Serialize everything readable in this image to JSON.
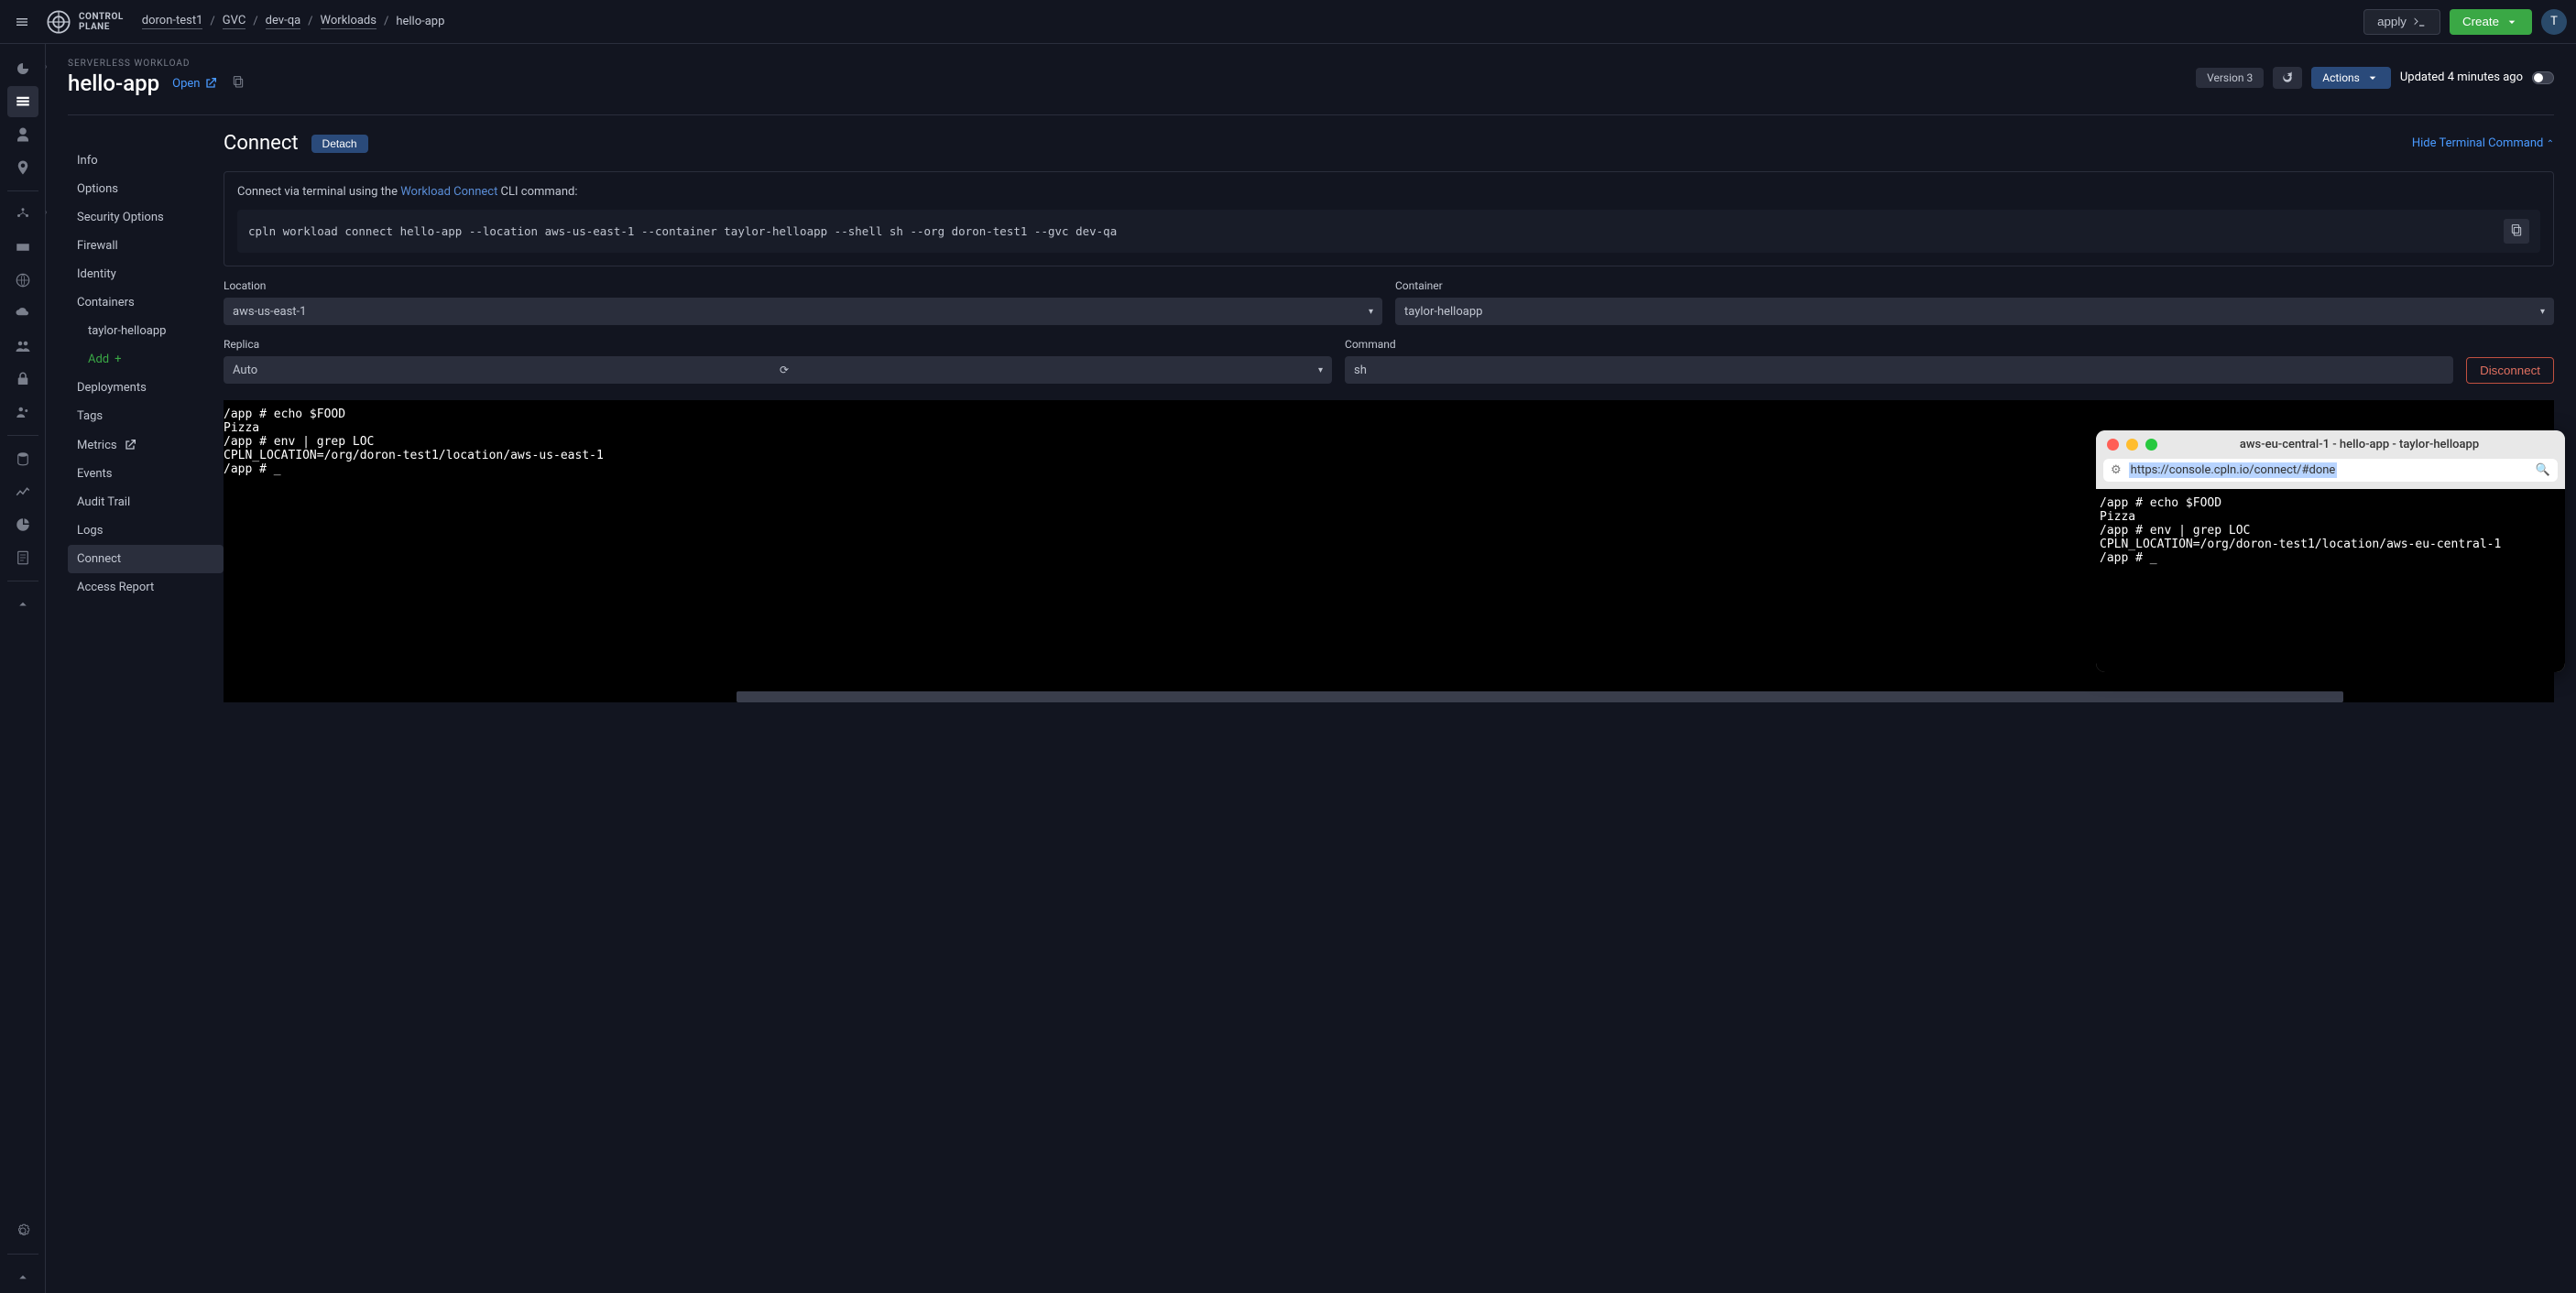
{
  "top": {
    "logo_line1": "CONTROL",
    "logo_line2": "PLANE",
    "breadcrumbs": [
      "doron-test1",
      "GVC",
      "dev-qa",
      "Workloads",
      "hello-app"
    ],
    "apply": "apply",
    "create": "Create",
    "avatar_letter": "T"
  },
  "header": {
    "subtitle": "SERVERLESS WORKLOAD",
    "title": "hello-app",
    "open": "Open",
    "version": "Version 3",
    "actions": "Actions",
    "updated": "Updated 4 minutes ago"
  },
  "sidenav": {
    "items": [
      "Info",
      "Options",
      "Security Options",
      "Firewall",
      "Identity",
      "Containers"
    ],
    "container_child": "taylor-helloapp",
    "add": "Add",
    "items2": [
      "Deployments",
      "Tags",
      "Metrics",
      "Events",
      "Audit Trail",
      "Logs",
      "Connect",
      "Access Report"
    ],
    "active": "Connect"
  },
  "connect": {
    "title": "Connect",
    "detach": "Detach",
    "hide": "Hide Terminal Command",
    "instr_pre": "Connect via terminal using the ",
    "instr_link": "Workload Connect",
    "instr_post": " CLI command:",
    "cmd": "cpln workload connect hello-app --location aws-us-east-1 --container taylor-helloapp --shell sh --org doron-test1 --gvc dev-qa",
    "fields": {
      "location_label": "Location",
      "location_value": "aws-us-east-1",
      "container_label": "Container",
      "container_value": "taylor-helloapp",
      "replica_label": "Replica",
      "replica_value": "Auto",
      "command_label": "Command",
      "command_value": "sh"
    },
    "disconnect": "Disconnect"
  },
  "terminal": "/app # echo $FOOD\nPizza\n/app # env | grep LOC\nCPLN_LOCATION=/org/doron-test1/location/aws-us-east-1\n/app # _",
  "float": {
    "title": "aws-eu-central-1 - hello-app - taylor-helloapp",
    "url": "https://console.cpln.io/connect/#done",
    "term": "/app # echo $FOOD\nPizza\n/app # env | grep LOC\nCPLN_LOCATION=/org/doron-test1/location/aws-eu-central-1\n/app # _"
  }
}
